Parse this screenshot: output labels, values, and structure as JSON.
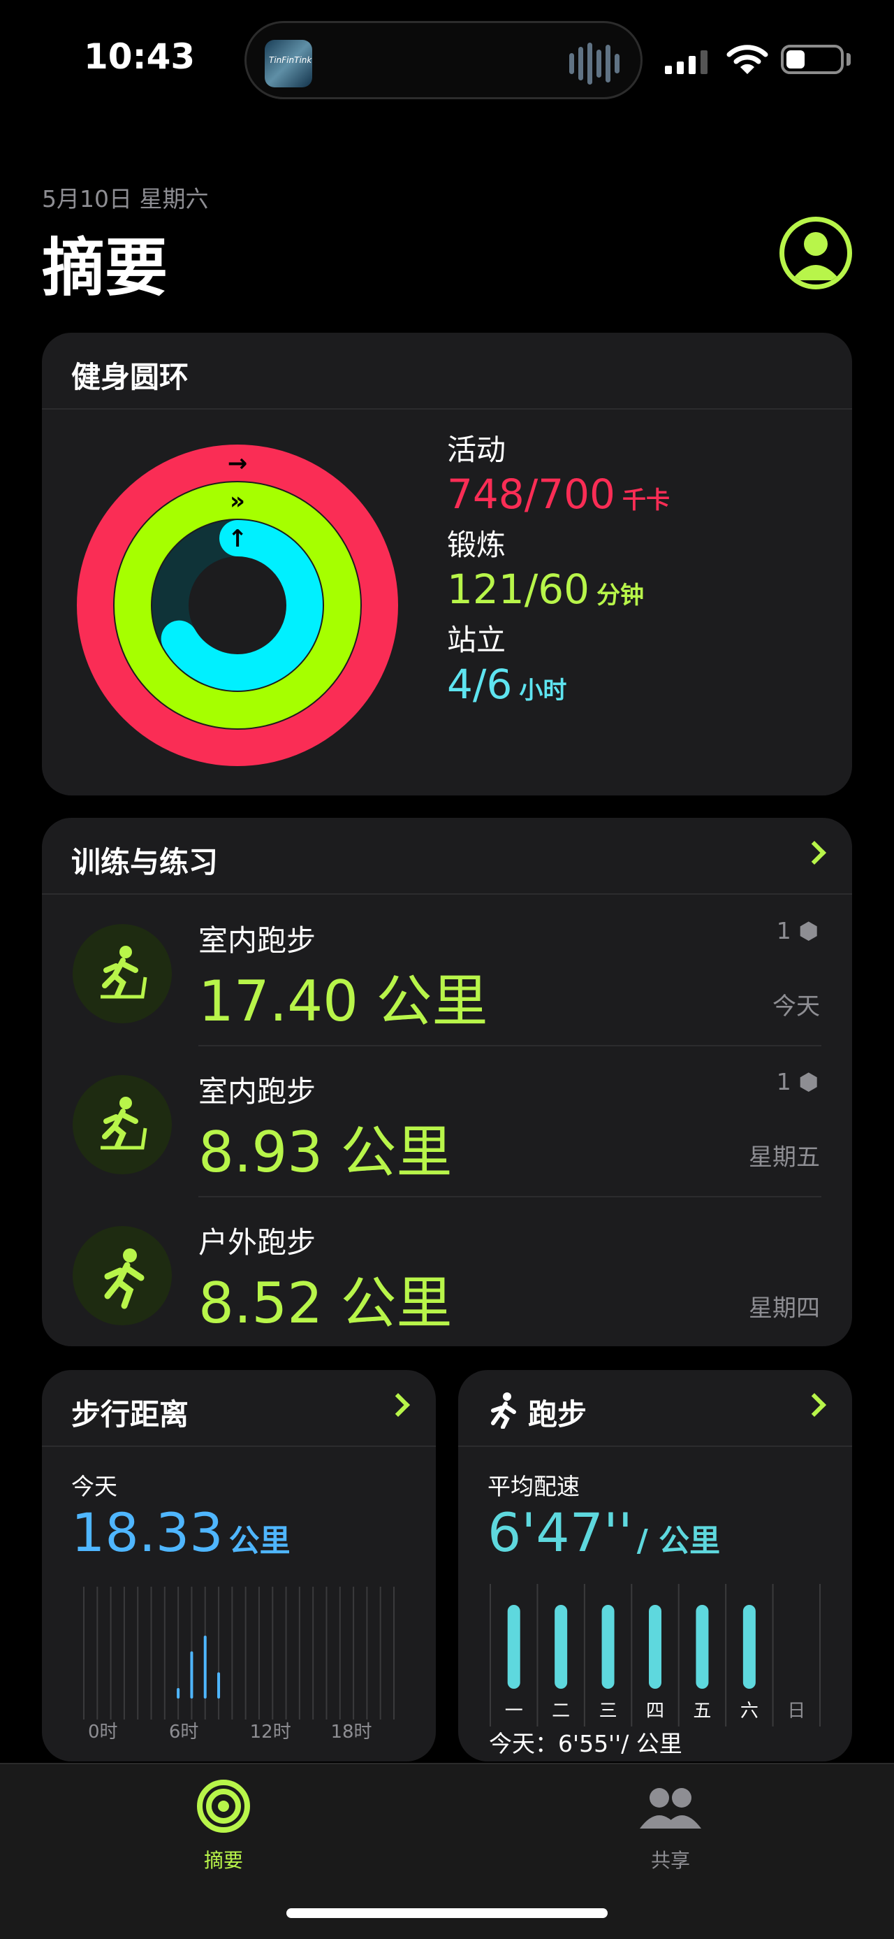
{
  "status_bar": {
    "time": "10:43",
    "island_art_text": "TinFinTink"
  },
  "header": {
    "date": "5月10日 星期六",
    "title": "摘要"
  },
  "rings": {
    "title": "健身圆环",
    "move": {
      "label": "活动",
      "value": "748/700",
      "unit": "千卡",
      "color": "#fa2d55",
      "fraction": 1.07
    },
    "exercise": {
      "label": "锻炼",
      "value": "121/60",
      "unit": "分钟",
      "color": "#a6ff00",
      "fraction": 2.02
    },
    "stand": {
      "label": "站立",
      "value": "4/6",
      "unit": "小时",
      "color": "#00f0ff",
      "fraction": 0.667
    }
  },
  "workouts": {
    "title": "训练与练习",
    "items": [
      {
        "name": "室内跑步",
        "distance": "17.40 公里",
        "count": "1",
        "day": "今天",
        "icon": "treadmill-icon"
      },
      {
        "name": "室内跑步",
        "distance": "8.93 公里",
        "count": "1",
        "day": "星期五",
        "icon": "treadmill-icon"
      },
      {
        "name": "户外跑步",
        "distance": "8.52 公里",
        "count": "",
        "day": "星期四",
        "icon": "running-icon"
      }
    ]
  },
  "walking": {
    "title": "步行距离",
    "label": "今天",
    "value": "18.33",
    "unit": "公里",
    "axis": [
      "0时",
      "6时",
      "12时",
      "18时"
    ],
    "hourly": [
      0,
      0,
      0,
      0,
      0,
      0,
      0,
      0.1,
      0.45,
      0.6,
      0.25,
      0,
      0,
      0,
      0,
      0,
      0,
      0,
      0,
      0,
      0,
      0,
      0,
      0
    ]
  },
  "running": {
    "title": "跑步",
    "label": "平均配速",
    "value": "6'47''",
    "unit": "/ 公里",
    "days": [
      "一",
      "二",
      "三",
      "四",
      "五",
      "六",
      "日"
    ],
    "pace_levels": [
      1,
      1,
      1,
      1,
      1,
      1,
      0
    ],
    "today_pace": "今天：6'55''/ 公里"
  },
  "tabbar": {
    "summary": "摘要",
    "sharing": "共享"
  }
}
